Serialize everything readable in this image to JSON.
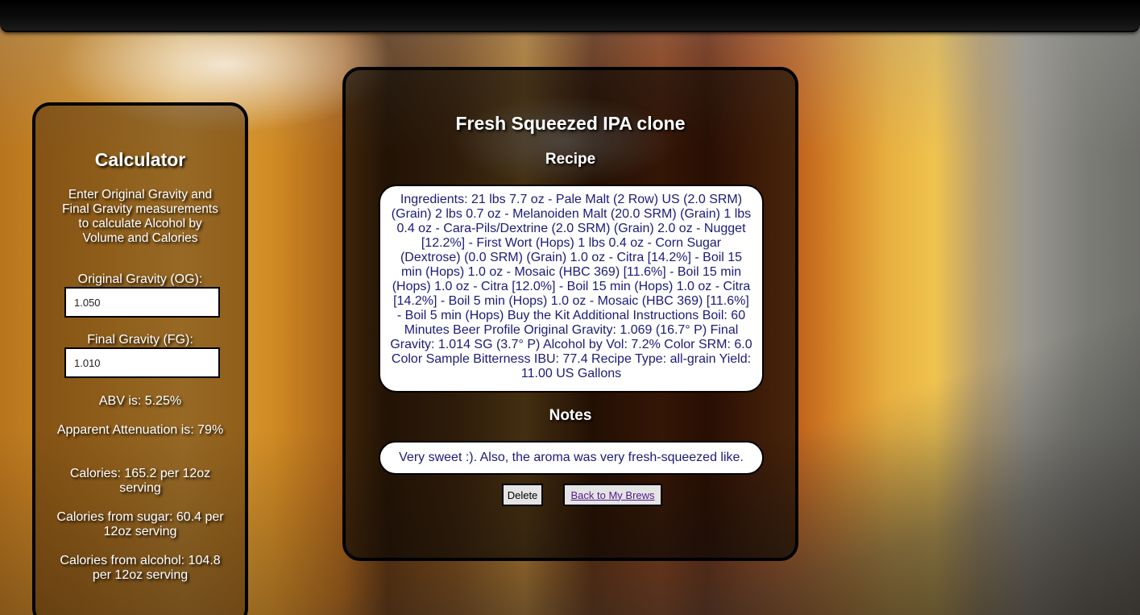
{
  "calculator": {
    "title": "Calculator",
    "intro": "Enter Original Gravity and Final Gravity measurements to calculate Alcohol by Volume and Calories",
    "og_label": "Original Gravity (OG):",
    "og_value": "1.050",
    "fg_label": "Final Gravity (FG):",
    "fg_value": "1.010",
    "abv": "ABV is: 5.25%",
    "attenuation": "Apparent Attenuation is: 79%",
    "calories": "Calories: 165.2 per 12oz serving",
    "calories_sugar": "Calories from sugar: 60.4 per 12oz serving",
    "calories_alcohol": "Calories from alcohol: 104.8 per 12oz serving"
  },
  "recipe": {
    "title": "Fresh Squeezed IPA clone",
    "recipe_heading": "Recipe",
    "ingredients": "Ingredients: 21 lbs 7.7 oz - Pale Malt (2 Row) US (2.0 SRM) (Grain) 2 lbs 0.7 oz - Melanoiden Malt (20.0 SRM) (Grain) 1 lbs 0.4 oz - Cara-Pils/Dextrine (2.0 SRM) (Grain) 2.0 oz - Nugget [12.2%] - First Wort (Hops) 1 lbs 0.4 oz - Corn Sugar (Dextrose) (0.0 SRM) (Grain) 1.0 oz - Citra [14.2%] - Boil 15 min (Hops) 1.0 oz - Mosaic (HBC 369) [11.6%] - Boil 15 min (Hops) 1.0 oz - Citra [12.0%] - Boil 15 min (Hops) 1.0 oz - Citra [14.2%] - Boil 5 min (Hops) 1.0 oz - Mosaic (HBC 369) [11.6%] - Boil 5 min (Hops) Buy the Kit Additional Instructions Boil: 60 Minutes Beer Profile Original Gravity: 1.069 (16.7° P) Final Gravity: 1.014 SG (3.7° P) Alcohol by Vol: 7.2% Color SRM: 6.0 Color Sample Bitterness IBU: 77.4 Recipe Type: all-grain Yield: 11.00 US Gallons",
    "notes_heading": "Notes",
    "notes": "Very sweet :). Also, the aroma was very fresh-squeezed like.",
    "delete_label": "Delete",
    "back_label": "Back to My Brews"
  },
  "colors": {
    "panel_border": "#000000",
    "box_text": "#1b1b7a",
    "link": "#551a8b"
  }
}
